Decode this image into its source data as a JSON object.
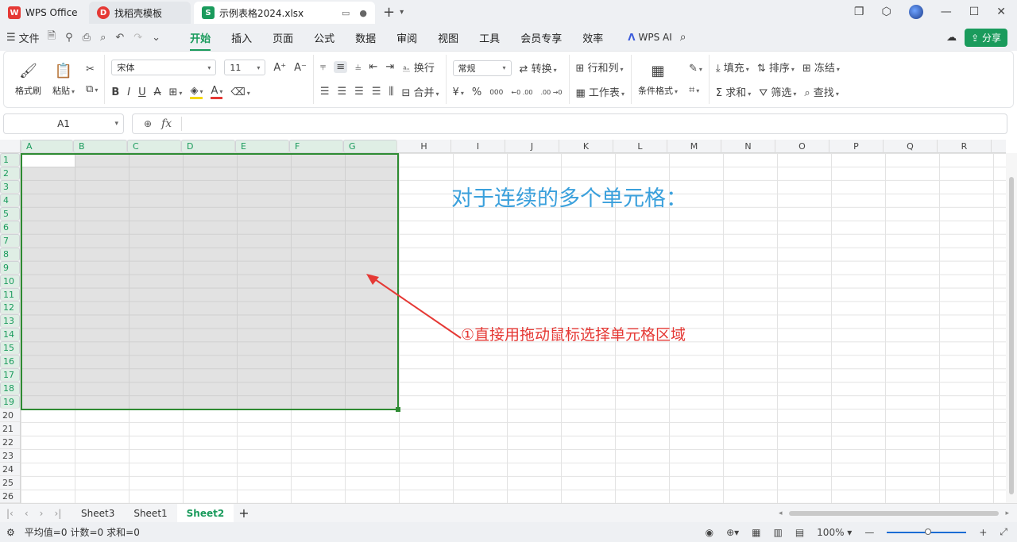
{
  "tabs": [
    {
      "label": "WPS Office"
    },
    {
      "label": "找稻壳模板"
    },
    {
      "label": "示例表格2024.xlsx"
    }
  ],
  "menu": {
    "file": "文件",
    "items": [
      "开始",
      "插入",
      "页面",
      "公式",
      "数据",
      "审阅",
      "视图",
      "工具",
      "会员专享",
      "效率"
    ],
    "active": "开始",
    "wps_ai": "WPS AI",
    "share": "分享"
  },
  "ribbon": {
    "format_painter": "格式刷",
    "paste": "粘贴",
    "font_name": "宋体",
    "font_size": "11",
    "wrap": "换行",
    "merge": "合并",
    "number_format": "常规",
    "convert": "转换",
    "rows_cols": "行和列",
    "worksheet": "工作表",
    "cond_format": "条件格式",
    "fill": "填充",
    "sort": "排序",
    "freeze": "冻结",
    "sum": "求和",
    "filter": "筛选",
    "find": "查找",
    "currency": "¥",
    "percent": "%",
    "thousands": "000",
    "inc_dec": "←0 .00",
    "dec_dec": ".00 →0"
  },
  "formula_bar": {
    "name_box": "A1",
    "fx": "fx",
    "formula": ""
  },
  "columns": [
    "A",
    "B",
    "C",
    "D",
    "E",
    "F",
    "G",
    "H",
    "I",
    "J",
    "K",
    "L",
    "M",
    "N",
    "O",
    "P",
    "Q",
    "R"
  ],
  "rows": [
    "1",
    "2",
    "3",
    "4",
    "5",
    "6",
    "7",
    "8",
    "9",
    "10",
    "11",
    "12",
    "13",
    "14",
    "15",
    "16",
    "17",
    "18",
    "19",
    "20",
    "21",
    "22",
    "23",
    "24",
    "25",
    "26"
  ],
  "selection": {
    "range": "A1:G19",
    "active": "A1"
  },
  "annotations": {
    "heading": "对于连续的多个单元格：",
    "note": "①直接用拖动鼠标选择单元格区域"
  },
  "sheets": [
    "Sheet3",
    "Sheet1",
    "Sheet2"
  ],
  "active_sheet": "Sheet2",
  "status": {
    "average": "平均值=0",
    "count": "计数=0",
    "sum": "求和=0",
    "zoom": "100%"
  },
  "colors": {
    "accent": "#1a9b5c",
    "selection_border": "#2e8b32",
    "heading": "#3aa0dc",
    "annotation": "#e53935"
  }
}
